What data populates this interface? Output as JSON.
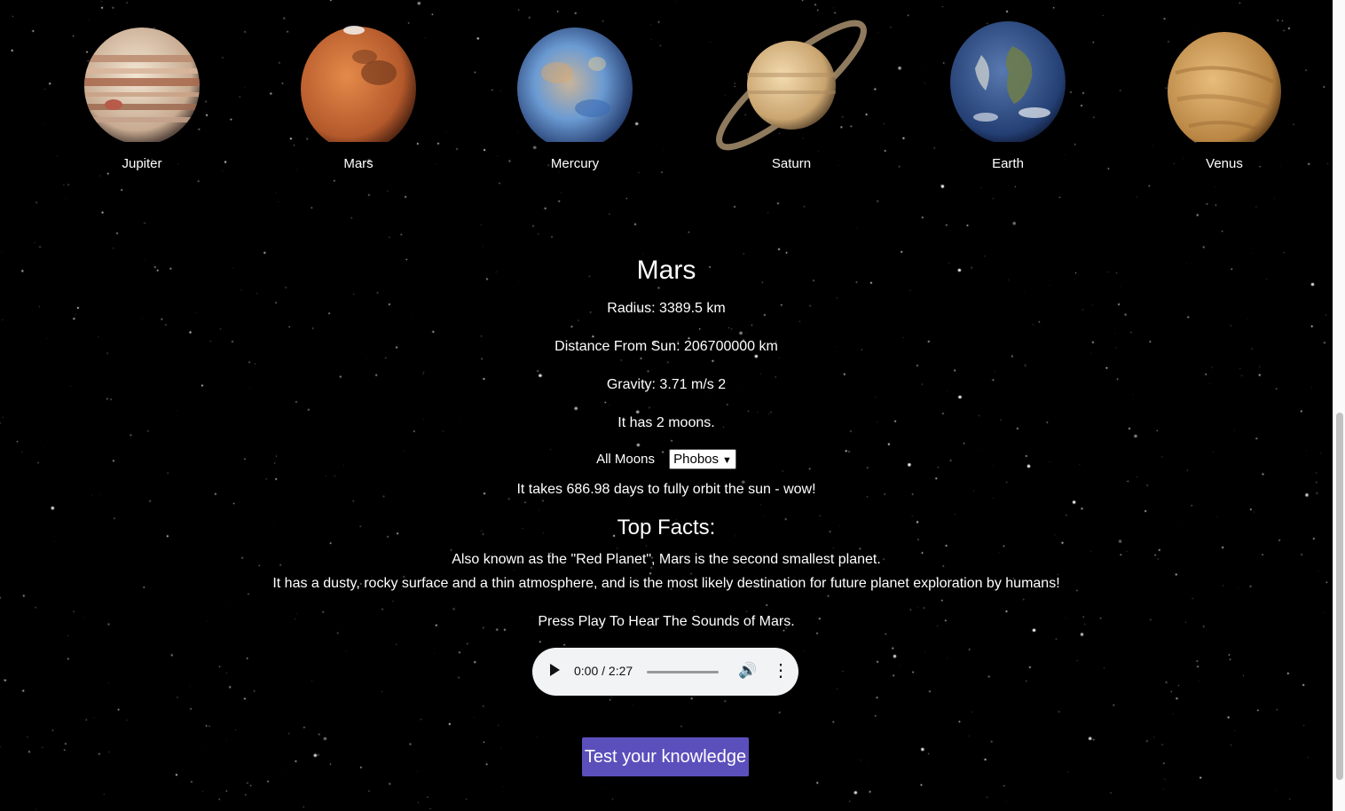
{
  "planets": [
    {
      "name": "Jupiter",
      "icon": "jupiter-image",
      "colors": [
        "#e9d7c2",
        "#b9876a",
        "#d8c4ad",
        "#9f5a3c"
      ]
    },
    {
      "name": "Mars",
      "icon": "mars-image",
      "colors": [
        "#d9733a",
        "#a24d24",
        "#5a2b17"
      ]
    },
    {
      "name": "Mercury",
      "icon": "mercury-image",
      "colors": [
        "#6f9fd6",
        "#d4a56b",
        "#2b4f8c"
      ]
    },
    {
      "name": "Saturn",
      "icon": "saturn-image",
      "colors": [
        "#e5c796",
        "#b89566",
        "#8f7458"
      ]
    },
    {
      "name": "Earth",
      "icon": "earth-image",
      "colors": [
        "#3b5d95",
        "#e8eef4",
        "#6b7a4a"
      ]
    },
    {
      "name": "Venus",
      "icon": "venus-image",
      "colors": [
        "#dcae6c",
        "#b98848",
        "#8a5e2c"
      ]
    }
  ],
  "selected": {
    "title": "Mars",
    "radius": "Radius: 3389.5 km",
    "distance": "Distance From Sun: 206700000 km",
    "gravity": "Gravity: 3.71 m/s 2",
    "moons": "It has 2 moons.",
    "moons_label": "All Moons",
    "moon_selected": "Phobos",
    "orbit": "It takes 686.98 days to fully orbit the sun - wow!",
    "facts_title": "Top Facts:",
    "fact_1": "Also known as the \"Red Planet\", Mars is the second smallest planet.",
    "fact_2": "It has a dusty, rocky surface and a thin atmosphere, and is the most likely destination for future planet exploration by humans!",
    "sound_prompt": "Press Play To Hear The Sounds of Mars."
  },
  "audio": {
    "time": "0:00 / 2:27",
    "progress": 0
  },
  "quiz_button": "Test your knowledge",
  "colors": {
    "accent": "#5b4fbc",
    "background": "#000000"
  }
}
